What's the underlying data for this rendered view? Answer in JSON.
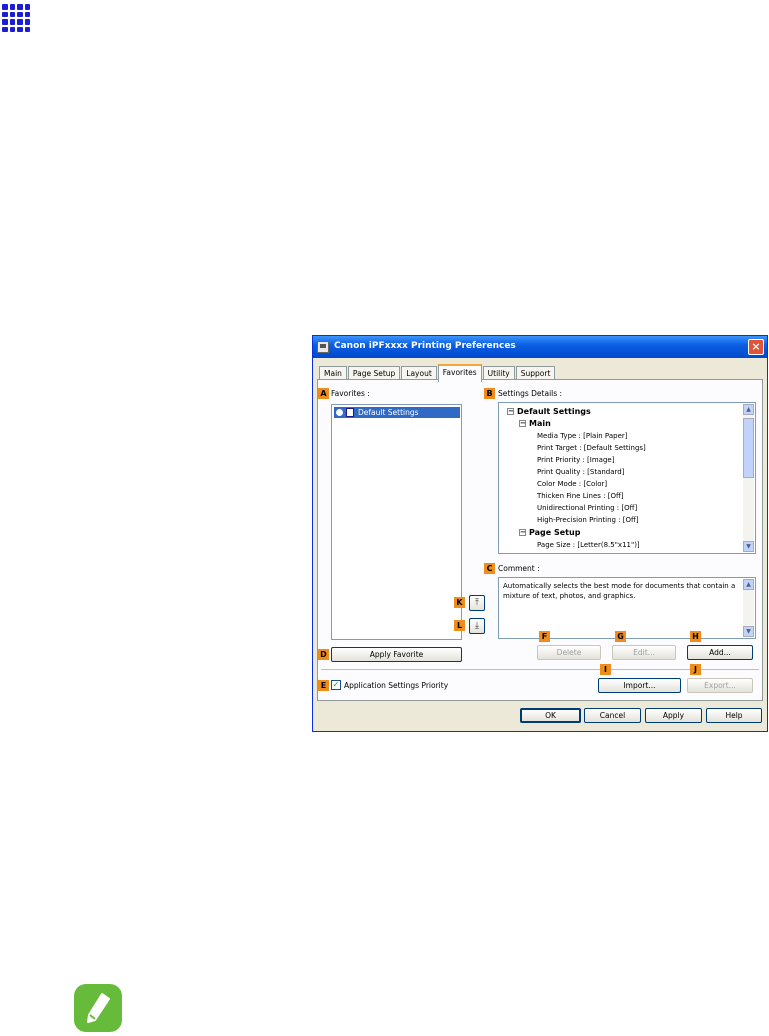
{
  "window": {
    "title": "Canon iPFxxxx Printing Preferences",
    "close_glyph": "×"
  },
  "tabs": [
    {
      "label": "Main"
    },
    {
      "label": "Page Setup"
    },
    {
      "label": "Layout"
    },
    {
      "label": "Favorites"
    },
    {
      "label": "Utility"
    },
    {
      "label": "Support"
    }
  ],
  "callouts": {
    "A": "A",
    "B": "B",
    "C": "C",
    "D": "D",
    "E": "E",
    "F": "F",
    "G": "G",
    "H": "H",
    "I": "I",
    "J": "J",
    "K": "K",
    "L": "L"
  },
  "favorites": {
    "label": "Favorites :",
    "items": [
      {
        "label": "Default Settings"
      }
    ],
    "apply_button": "Apply Favorite"
  },
  "settings_details": {
    "label": "Settings Details :",
    "lines": [
      "Default Settings",
      "Main",
      "Media Type : [Plain Paper]",
      "Print Target : [Default Settings]",
      "Print Priority : [Image]",
      "Print Quality : [Standard]",
      "Color Mode : [Color]",
      "Thicken Fine Lines : [Off]",
      "Unidirectional Printing : [Off]",
      "High-Precision Printing : [Off]",
      "Page Setup",
      "Page Size : [Letter(8.5\"x11\")]"
    ]
  },
  "comment": {
    "label": "Comment :",
    "text": "Automatically selects the best mode for documents that contain a mixture of text, photos, and graphics."
  },
  "buttons": {
    "delete": "Delete",
    "edit": "Edit...",
    "add": "Add...",
    "import": "Import...",
    "export": "Export...",
    "ok": "OK",
    "cancel": "Cancel",
    "apply": "Apply",
    "help": "Help",
    "move_up_glyph": "⤒",
    "move_down_glyph": "⤓"
  },
  "app_settings_priority": {
    "label": "Application Settings Priority",
    "checked": true,
    "check_glyph": "✓"
  },
  "icons": [
    "grid-icon",
    "printer-icon",
    "note-pencil-icon"
  ],
  "colors": {
    "title_bar": "#0a5fe3",
    "callout": "#ee8d1c",
    "selection": "#316ac5",
    "note_green": "#66bb3a"
  }
}
